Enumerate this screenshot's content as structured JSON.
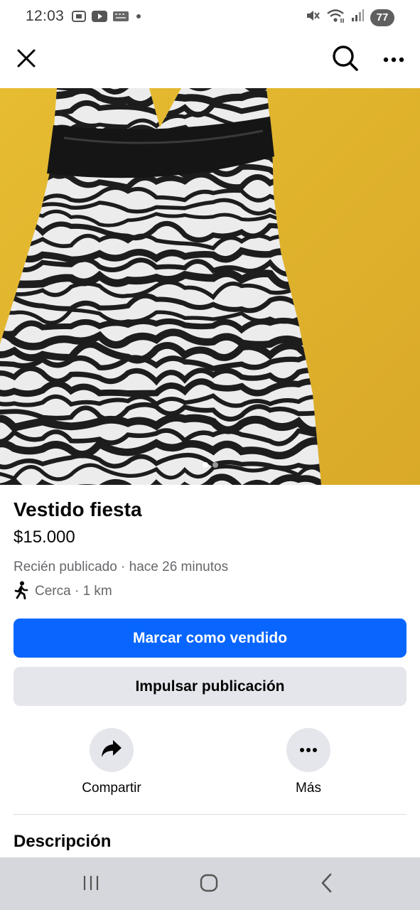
{
  "status_bar": {
    "time": "12:03",
    "battery": "77",
    "left_icons": [
      "screenshot-icon",
      "youtube-icon",
      "keyboard-icon",
      "notification-dot-icon"
    ],
    "right_icons": [
      "mute-icon",
      "wifi-icon",
      "signal-icon"
    ]
  },
  "top_nav": {
    "icons": [
      "close-icon",
      "search-icon",
      "more-options-icon"
    ]
  },
  "photo": {
    "page_count": 2,
    "active_page": 1,
    "colors": {
      "background": "#e0b42a",
      "stripe_dark": "#1d1d1d",
      "stripe_light": "#ececec",
      "waistband": "#151515"
    }
  },
  "listing": {
    "title": "Vestido fiesta",
    "price": "$15.000",
    "posted": "Recién publicado · hace 26 minutos",
    "location": "Cerca · 1 km",
    "location_icon": "walking-person-icon"
  },
  "buttons": {
    "mark_sold": "Marcar como vendido",
    "boost": "Impulsar publicación"
  },
  "actions": [
    {
      "label": "Compartir",
      "icon": "share-arrow-icon"
    },
    {
      "label": "Más",
      "icon": "more-icon"
    }
  ],
  "description": {
    "heading": "Descripción"
  },
  "system_nav": {
    "icons": [
      "recent-apps-icon",
      "home-icon",
      "back-icon"
    ]
  },
  "colors": {
    "primary": "#0866ff",
    "secondary_button": "#e4e6eb",
    "secondary_text": "#65676b",
    "system_nav_bg": "#d6d7dc"
  }
}
